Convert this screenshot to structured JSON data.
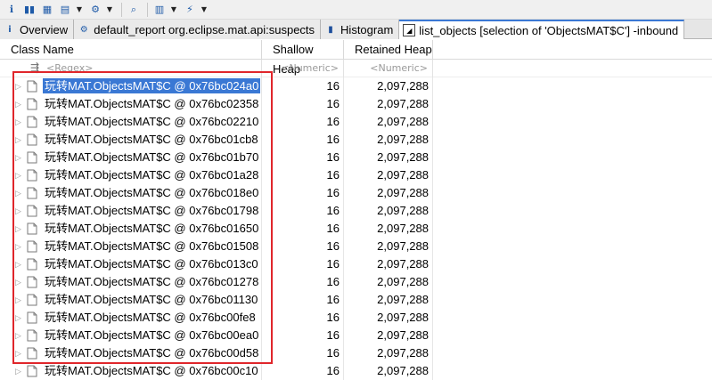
{
  "toolbar": {
    "buttons": [
      "info-icon",
      "histogram-icon",
      "sql-icon",
      "query-icon",
      "search-icon",
      "export-icon",
      "report-icon",
      "settings-icon"
    ]
  },
  "tabs": [
    {
      "label": "Overview",
      "icon": "info-icon"
    },
    {
      "label": "default_report  org.eclipse.mat.api:suspects",
      "icon": "report-icon"
    },
    {
      "label": "Histogram",
      "icon": "histogram-icon"
    },
    {
      "label": "list_objects [selection of 'ObjectsMAT$C'] -inbound",
      "icon": "list-icon",
      "active": true
    }
  ],
  "table": {
    "columns": [
      "Class Name",
      "Shallow Heap",
      "Retained Heap"
    ],
    "filter": {
      "regex": "<Regex>",
      "numeric_shallow": "<Numeric>",
      "numeric_retained": "<Numeric>"
    },
    "rows": [
      {
        "name": "玩转MAT.ObjectsMAT$C @ 0x76bc024a0",
        "shallow": "16",
        "retained": "2,097,288",
        "selected": true
      },
      {
        "name": "玩转MAT.ObjectsMAT$C @ 0x76bc02358",
        "shallow": "16",
        "retained": "2,097,288"
      },
      {
        "name": "玩转MAT.ObjectsMAT$C @ 0x76bc02210",
        "shallow": "16",
        "retained": "2,097,288"
      },
      {
        "name": "玩转MAT.ObjectsMAT$C @ 0x76bc01cb8",
        "shallow": "16",
        "retained": "2,097,288"
      },
      {
        "name": "玩转MAT.ObjectsMAT$C @ 0x76bc01b70",
        "shallow": "16",
        "retained": "2,097,288"
      },
      {
        "name": "玩转MAT.ObjectsMAT$C @ 0x76bc01a28",
        "shallow": "16",
        "retained": "2,097,288"
      },
      {
        "name": "玩转MAT.ObjectsMAT$C @ 0x76bc018e0",
        "shallow": "16",
        "retained": "2,097,288"
      },
      {
        "name": "玩转MAT.ObjectsMAT$C @ 0x76bc01798",
        "shallow": "16",
        "retained": "2,097,288"
      },
      {
        "name": "玩转MAT.ObjectsMAT$C @ 0x76bc01650",
        "shallow": "16",
        "retained": "2,097,288"
      },
      {
        "name": "玩转MAT.ObjectsMAT$C @ 0x76bc01508",
        "shallow": "16",
        "retained": "2,097,288"
      },
      {
        "name": "玩转MAT.ObjectsMAT$C @ 0x76bc013c0",
        "shallow": "16",
        "retained": "2,097,288"
      },
      {
        "name": "玩转MAT.ObjectsMAT$C @ 0x76bc01278",
        "shallow": "16",
        "retained": "2,097,288"
      },
      {
        "name": "玩转MAT.ObjectsMAT$C @ 0x76bc01130",
        "shallow": "16",
        "retained": "2,097,288"
      },
      {
        "name": "玩转MAT.ObjectsMAT$C @ 0x76bc00fe8",
        "shallow": "16",
        "retained": "2,097,288"
      },
      {
        "name": "玩转MAT.ObjectsMAT$C @ 0x76bc00ea0",
        "shallow": "16",
        "retained": "2,097,288"
      },
      {
        "name": "玩转MAT.ObjectsMAT$C @ 0x76bc00d58",
        "shallow": "16",
        "retained": "2,097,288"
      },
      {
        "name": "玩转MAT.ObjectsMAT$C @ 0x76bc00c10",
        "shallow": "16",
        "retained": "2,097,288"
      }
    ]
  },
  "colors": {
    "selection": "#3a78d4",
    "highlight_box": "#e0262b"
  }
}
